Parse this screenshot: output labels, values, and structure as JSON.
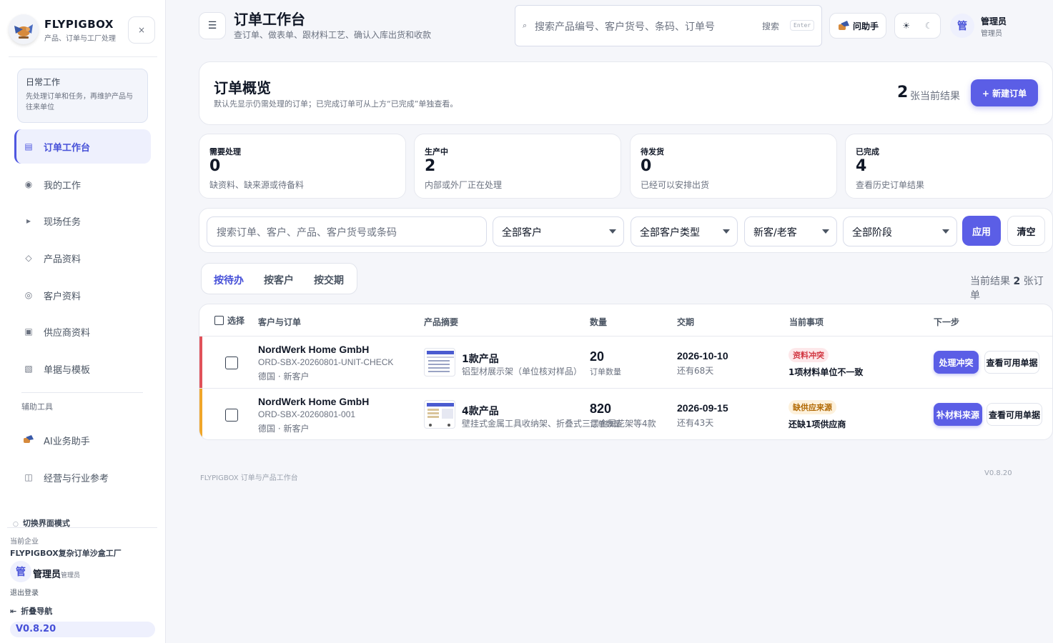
{
  "app": {
    "name": "FLYPIGBOX",
    "subtitle": "产品、订单与工厂处理",
    "close": "×"
  },
  "sidebar": {
    "daily": {
      "title": "日常工作",
      "desc": "先处理订单和任务，再维护产品与往来单位"
    },
    "items": [
      {
        "label": "订单工作台",
        "icon": "▤"
      },
      {
        "label": "我的工作",
        "icon": "◉"
      },
      {
        "label": "现场任务",
        "icon": "▸"
      },
      {
        "label": "产品资料",
        "icon": "◇"
      },
      {
        "label": "客户资料",
        "icon": "◎"
      },
      {
        "label": "供应商资料",
        "icon": "▣"
      },
      {
        "label": "单据与模板",
        "icon": "▧"
      }
    ],
    "aux_title": "辅助工具",
    "aux_items": [
      {
        "label": "AI业务助手"
      },
      {
        "label": "经营与行业参考",
        "icon": "◫"
      }
    ],
    "mode": "切换界面模式",
    "company_label": "当前企业",
    "company": "FLYPIGBOX复杂订单沙盒工厂",
    "user": {
      "avatar": "管",
      "name": "管理员",
      "role": "管理员"
    },
    "logout": "退出登录",
    "collapse": "折叠导航",
    "version": "V0.8.20"
  },
  "topbar": {
    "menu_icon": "☰",
    "title": "订单工作台",
    "subtitle": "查订单、做表单、跟材料工艺、确认入库出货和收款",
    "search": {
      "icon": "⌕",
      "placeholder": "搜索产品编号、客户货号、条码、订单号",
      "label": "搜索",
      "key": "Enter"
    },
    "assistant": "问助手",
    "theme": {
      "sun": "☀",
      "moon": "☾"
    },
    "user": {
      "avatar": "管",
      "name": "管理员",
      "role": "管理员"
    }
  },
  "overview": {
    "title": "订单概览",
    "desc": "默认先显示仍需处理的订单；已完成订单可从上方“已完成”单独查看。",
    "count": "2",
    "count_label": "张当前结果",
    "new_button": "+ 新建订单"
  },
  "stats": [
    {
      "label": "需要处理",
      "value": "0",
      "desc": "缺资料、缺来源或待备料"
    },
    {
      "label": "生产中",
      "value": "2",
      "desc": "内部或外厂正在处理"
    },
    {
      "label": "待发货",
      "value": "0",
      "desc": "已经可以安排出货"
    },
    {
      "label": "已完成",
      "value": "4",
      "desc": "查看历史订单结果"
    }
  ],
  "filters": {
    "search_placeholder": "搜索订单、客户、产品、客户货号或条码",
    "customer": "全部客户",
    "customer_type": "全部客户类型",
    "new_old": "新客/老客",
    "stage": "全部阶段",
    "apply": "应用",
    "clear": "清空"
  },
  "tabs": [
    "按待办",
    "按客户",
    "按交期"
  ],
  "results": {
    "prefix": "当前结果",
    "count": "2",
    "suffix": "张订单"
  },
  "table": {
    "headers": [
      "选择",
      "客户与订单",
      "产品摘要",
      "数量",
      "交期",
      "当前事项",
      "下一步"
    ],
    "rows": [
      {
        "customer": "NordWerk Home GmbH",
        "order_no": "ORD-SBX-20260801-UNIT-CHECK",
        "meta": "德国 · 新客户",
        "product_count": "1款产品",
        "product_desc": "铝型材展示架（单位核对样品）",
        "qty": "20",
        "qty_label": "订单数量",
        "due": "2026-10-10",
        "due_left": "还有68天",
        "badge": "资料冲突",
        "issue": "1项材料单位不一致",
        "action": "处理冲突",
        "action2": "查看可用单据",
        "color": "#e0525a"
      },
      {
        "customer": "NordWerk Home GmbH",
        "order_no": "ORD-SBX-20260801-001",
        "meta": "德国 · 新客户",
        "product_count": "4款产品",
        "product_desc": "壁挂式金属工具收纳架、折叠式三层金属花架等4款",
        "qty": "820",
        "qty_label": "订单数量",
        "due": "2026-09-15",
        "due_left": "还有43天",
        "badge": "缺供应来源",
        "issue": "还缺1项供应商",
        "action": "补材料来源",
        "action2": "查看可用单据",
        "color": "#f0a62a"
      }
    ]
  },
  "footer": {
    "left": "FLYPIGBOX 订单与产品工作台",
    "right": "V0.8.20"
  }
}
